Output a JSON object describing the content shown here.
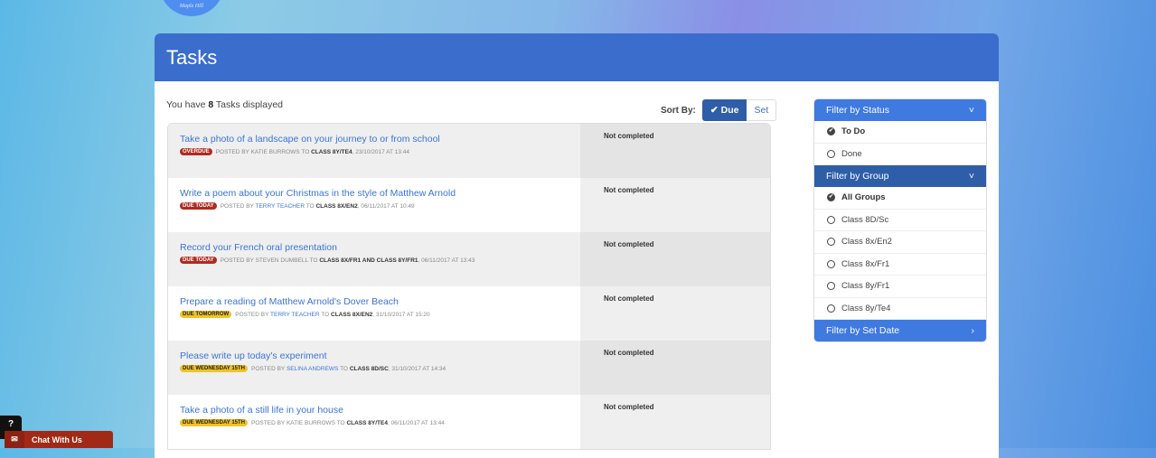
{
  "logo": {
    "text": "Maple Hill"
  },
  "header": {
    "title": "Tasks"
  },
  "summary": {
    "prefix": "You have",
    "count": "8",
    "suffix": "Tasks displayed"
  },
  "sort": {
    "label": "Sort By:",
    "options": [
      {
        "label": "Due",
        "active": true
      },
      {
        "label": "Set",
        "active": false
      }
    ]
  },
  "tasks": [
    {
      "title": "Take a photo of a landscape on your journey to or from school",
      "badge": "Overdue",
      "badge_color": "#b12a20",
      "posted_by_prefix": "Posted by",
      "poster": "Katie Burrows",
      "poster_link": false,
      "to": "to",
      "class": "Class 8Y/Te4",
      "date": ", 23/10/2017 at 13:44",
      "status": "Not completed"
    },
    {
      "title": "Write a poem about your Christmas in the style of Matthew Arnold",
      "badge": "Due Today",
      "badge_color": "#b12a20",
      "posted_by_prefix": "Posted by",
      "poster": "Terry Teacher",
      "poster_link": true,
      "to": "to",
      "class": "Class 8X/En2",
      "date": ", 06/11/2017 at 10:49",
      "status": "Not completed"
    },
    {
      "title": "Record your French oral presentation",
      "badge": "Due Today",
      "badge_color": "#b12a20",
      "posted_by_prefix": "Posted by",
      "poster": "Steven Dumbell",
      "poster_link": false,
      "to": "to",
      "class": "Class 8X/Fr1 and Class 8Y/Fr1",
      "date": ", 06/11/2017 at 13:43",
      "status": "Not completed"
    },
    {
      "title": "Prepare a reading of Matthew Arnold's Dover Beach",
      "badge": "Due Tomorrow",
      "badge_color": "#f0c325",
      "posted_by_prefix": "Posted by",
      "poster": "Terry Teacher",
      "poster_link": true,
      "to": "to",
      "class": "Class 8X/En2",
      "date": ", 31/10/2017 at 15:20",
      "status": "Not completed"
    },
    {
      "title": "Please write up today's experiment",
      "badge": "Due Wednesday 15th",
      "badge_color": "#f0c325",
      "posted_by_prefix": "Posted by",
      "poster": "Selina Andrews",
      "poster_link": true,
      "to": "to",
      "class": "Class 8D/Sc",
      "date": ", 31/10/2017 at 14:34",
      "status": "Not completed"
    },
    {
      "title": "Take a photo of a still life in your house",
      "badge": "Due Wednesday 15th",
      "badge_color": "#f0c325",
      "posted_by_prefix": "Posted by",
      "poster": "Katie Burrows",
      "poster_link": false,
      "to": "to",
      "class": "Class 8Y/Te4",
      "date": ", 06/11/2017 at 13:44",
      "status": "Not completed"
    }
  ],
  "filters": {
    "status": {
      "title": "Filter by Status",
      "items": [
        {
          "label": "To Do",
          "selected": true
        },
        {
          "label": "Done",
          "selected": false
        }
      ]
    },
    "group": {
      "title": "Filter by Group",
      "items": [
        {
          "label": "All Groups",
          "selected": true
        },
        {
          "label": "Class 8D/Sc",
          "selected": false
        },
        {
          "label": "Class 8x/En2",
          "selected": false
        },
        {
          "label": "Class 8x/Fr1",
          "selected": false
        },
        {
          "label": "Class 8y/Fr1",
          "selected": false
        },
        {
          "label": "Class 8y/Te4",
          "selected": false
        }
      ]
    },
    "set_date": {
      "title": "Filter by Set Date"
    }
  },
  "help": {
    "icon": "question-icon",
    "label": "?"
  },
  "chat": {
    "label": "Chat With Us",
    "icon": "envelope-icon"
  }
}
